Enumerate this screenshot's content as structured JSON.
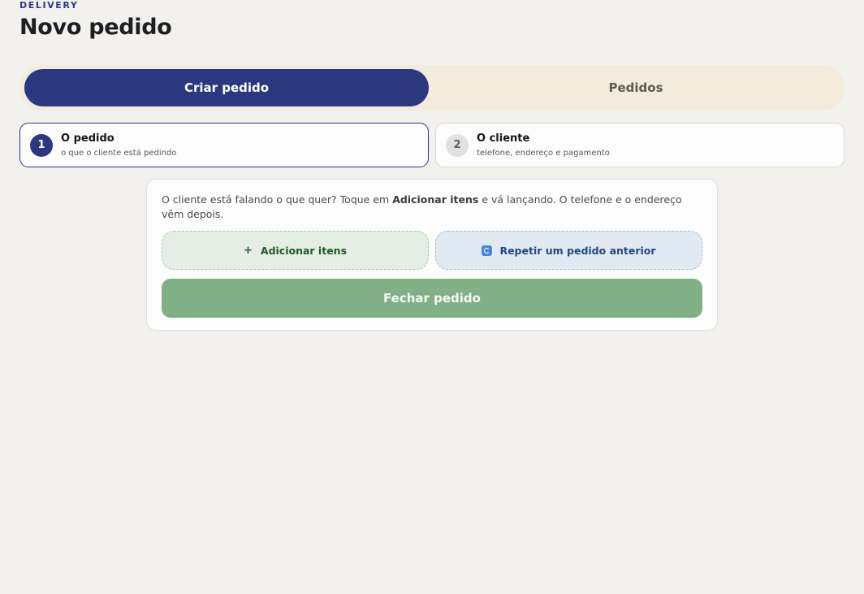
{
  "header": {
    "kicker": "DELIVERY",
    "title": "Novo pedido"
  },
  "tabs": [
    {
      "label": "Criar pedido",
      "active": true
    },
    {
      "label": "Pedidos",
      "active": false
    }
  ],
  "steps": [
    {
      "number": "1",
      "title": "O pedido",
      "subtitle": "o que o cliente está pedindo",
      "active": true
    },
    {
      "number": "2",
      "title": "O cliente",
      "subtitle": "telefone, endereço e pagamento",
      "active": false
    }
  ],
  "order_card": {
    "hint_before": "O cliente está falando o que quer? Toque em ",
    "hint_bold": "Adicionar itens",
    "hint_after": " e vá lançando. O telefone e o endereço vêm depois.",
    "add_items": {
      "glyph": "+",
      "label": "Adicionar itens",
      "icon": "plus-icon"
    },
    "repeat_order": {
      "label": "Repetir um pedido anterior",
      "icon": "repeat-icon"
    },
    "close_order_label": "Fechar pedido"
  },
  "colors": {
    "primary": "#2b3880",
    "tabbar_bg": "#f3ebdb",
    "close_button": "#82b086",
    "add_button_bg": "#e4eee4",
    "repeat_button_bg": "#e1e9f3",
    "page_bg": "#f2f1ed"
  }
}
